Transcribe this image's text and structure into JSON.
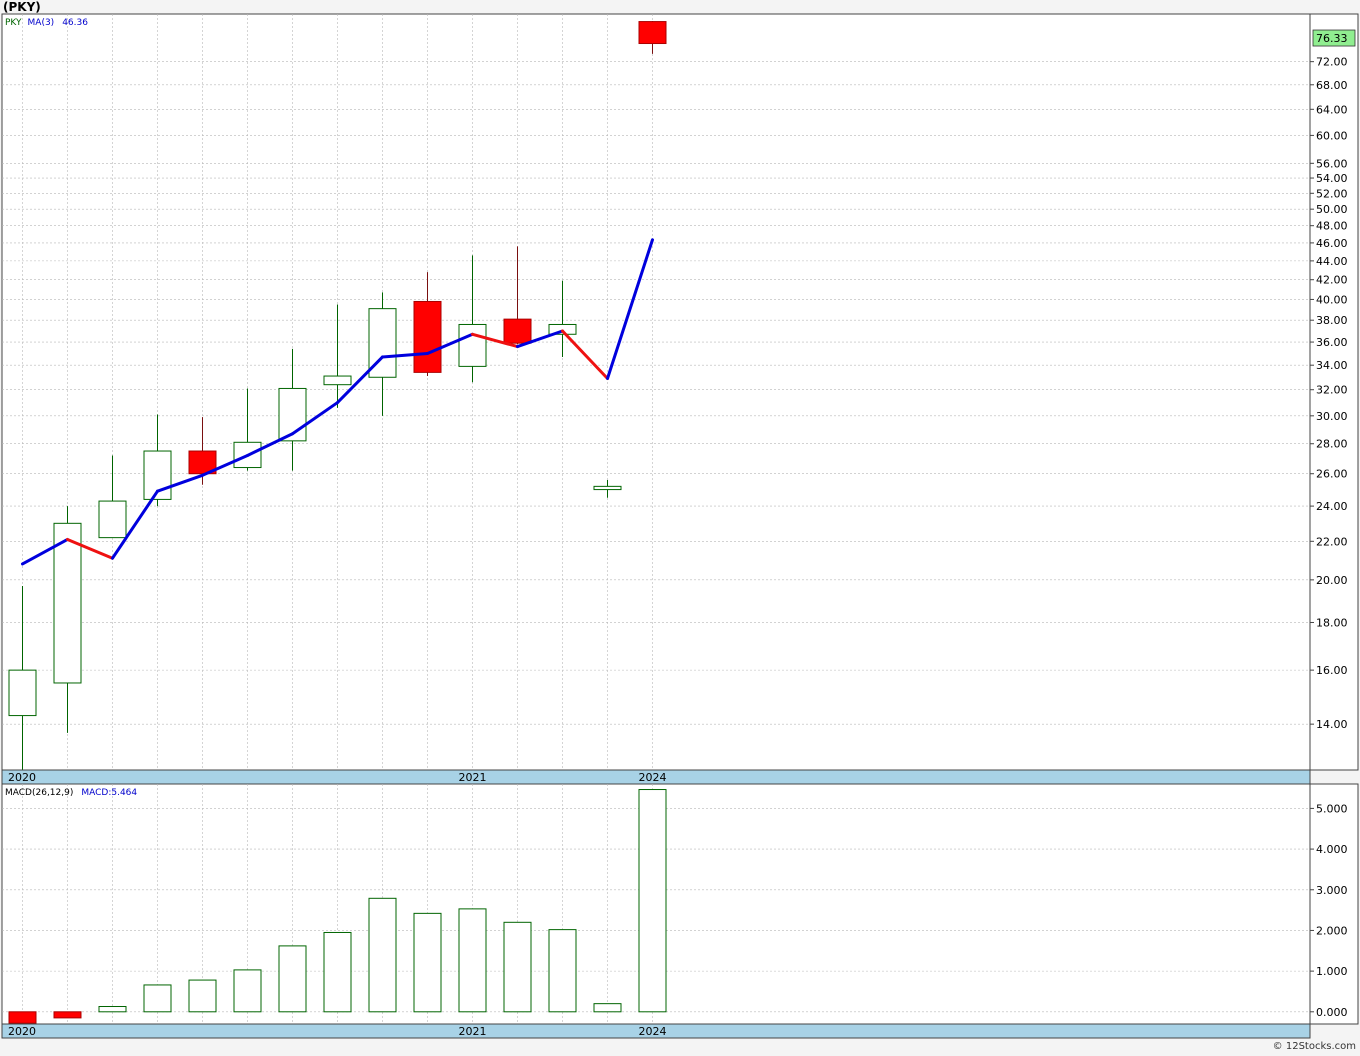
{
  "header": {
    "title": "(PKY)"
  },
  "footer": {
    "credit": "© 12Stocks.com"
  },
  "colors": {
    "up": "#006400",
    "down": "#ff0000",
    "upFill": "#ffffff",
    "ma_up": "#0000dd",
    "ma_down": "#ee1111",
    "grid": "#b8b8b8",
    "date_band": "#a8d2e6",
    "price_badge": "#90ee90"
  },
  "price_panel": {
    "ticker": "PKY",
    "ma_label": "MA(3)",
    "ma_value": "46.36",
    "last_price": "76.33",
    "ytick_labels": [
      "14.00",
      "16.00",
      "18.00",
      "20.00",
      "22.00",
      "24.00",
      "26.00",
      "28.00",
      "30.00",
      "32.00",
      "34.00",
      "36.00",
      "38.00",
      "40.00",
      "42.00",
      "44.00",
      "46.00",
      "48.00",
      "50.00",
      "52.00",
      "54.00",
      "56.00",
      "60.00",
      "64.00",
      "68.00",
      "72.00"
    ]
  },
  "macd_panel": {
    "label": "MACD(26,12,9)",
    "value_label": "MACD:5.464",
    "ytick_labels": [
      "0.000",
      "1.000",
      "2.000",
      "3.000",
      "4.000",
      "5.000"
    ]
  },
  "x_labels": [
    {
      "index": 0,
      "text": "2020"
    },
    {
      "index": 10,
      "text": "2021"
    },
    {
      "index": 14,
      "text": "2024"
    }
  ],
  "chart_data": [
    {
      "type": "candlestick",
      "title": "(PKY)",
      "scale": "log",
      "ylim": [
        12.5,
        81
      ],
      "candles": [
        {
          "open": 14.3,
          "high": 19.7,
          "low": 12.5,
          "close": 16.0
        },
        {
          "open": 15.5,
          "high": 24.0,
          "low": 13.7,
          "close": 23.0
        },
        {
          "open": 22.2,
          "high": 27.2,
          "low": 22.2,
          "close": 24.3
        },
        {
          "open": 24.4,
          "high": 30.1,
          "low": 24.0,
          "close": 27.5
        },
        {
          "open": 27.5,
          "high": 29.9,
          "low": 25.3,
          "close": 26.0
        },
        {
          "open": 26.4,
          "high": 32.1,
          "low": 26.2,
          "close": 28.1
        },
        {
          "open": 28.2,
          "high": 35.4,
          "low": 26.2,
          "close": 32.1
        },
        {
          "open": 32.4,
          "high": 39.5,
          "low": 30.6,
          "close": 33.1
        },
        {
          "open": 33.0,
          "high": 40.7,
          "low": 30.0,
          "close": 39.1
        },
        {
          "open": 39.8,
          "high": 42.8,
          "low": 33.1,
          "close": 33.4
        },
        {
          "open": 33.9,
          "high": 44.6,
          "low": 32.6,
          "close": 37.6
        },
        {
          "open": 38.1,
          "high": 45.6,
          "low": 35.8,
          "close": 35.9
        },
        {
          "open": 36.7,
          "high": 41.9,
          "low": 34.7,
          "close": 37.6
        },
        {
          "open": 25.0,
          "high": 25.6,
          "low": 24.5,
          "close": 25.2
        },
        {
          "open": 79.5,
          "high": 79.6,
          "low": 73.4,
          "close": 75.3
        }
      ],
      "ma": {
        "name": "MA(3)",
        "values": [
          20.8,
          22.1,
          21.1,
          24.9,
          25.9,
          27.2,
          28.7,
          31.0,
          34.7,
          35.0,
          36.7,
          35.6,
          37.0,
          32.9,
          46.36
        ]
      },
      "last_value": 76.33
    },
    {
      "type": "bar",
      "title": "MACD(26,12,9)",
      "ylim": [
        -0.3,
        5.6
      ],
      "values": [
        -0.28,
        -0.15,
        0.13,
        0.66,
        0.78,
        1.03,
        1.62,
        1.95,
        2.79,
        2.42,
        2.53,
        2.2,
        2.02,
        0.2,
        5.464
      ]
    }
  ]
}
